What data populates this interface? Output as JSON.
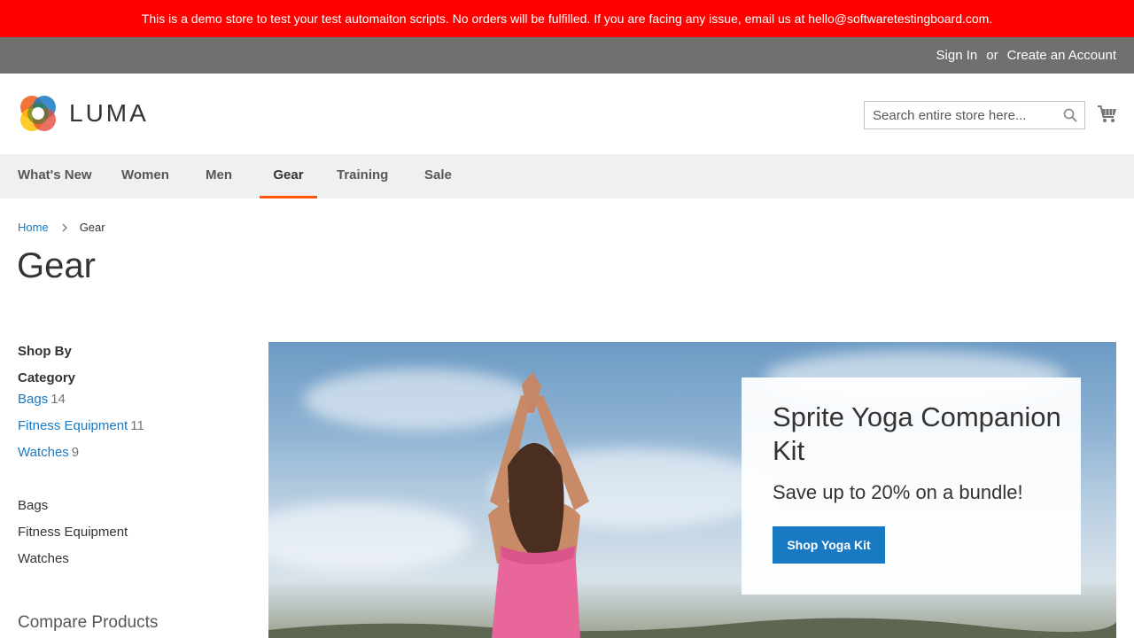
{
  "banner": {
    "text": "This is a demo store to test your test automaiton scripts. No orders will be fulfilled. If you are facing any issue, email us at hello@softwaretestingboard.com."
  },
  "header": {
    "sign_in": "Sign In",
    "or": "or",
    "create_account": "Create an Account",
    "logo_text": "LUMA",
    "search_placeholder": "Search entire store here..."
  },
  "nav": {
    "items": [
      {
        "label": "What's New"
      },
      {
        "label": "Women"
      },
      {
        "label": "Men"
      },
      {
        "label": "Gear"
      },
      {
        "label": "Training"
      },
      {
        "label": "Sale"
      }
    ],
    "active": "Gear"
  },
  "breadcrumbs": {
    "home": "Home",
    "current": "Gear"
  },
  "page_title": "Gear",
  "sidebar": {
    "shop_by": "Shop By",
    "filter_title": "Category",
    "filters": [
      {
        "label": "Bags",
        "count": "14"
      },
      {
        "label": "Fitness Equipment",
        "count": "11"
      },
      {
        "label": "Watches",
        "count": "9"
      }
    ],
    "categories": [
      {
        "label": "Bags"
      },
      {
        "label": "Fitness Equipment"
      },
      {
        "label": "Watches"
      }
    ],
    "compare_title": "Compare Products"
  },
  "hero": {
    "title": "Sprite Yoga Companion Kit",
    "subtitle": "Save up to 20% on a bundle!",
    "button": "Shop Yoga Kit"
  },
  "colors": {
    "banner": "#ff0101",
    "panel": "#6e716e",
    "link": "#1979c3",
    "nav_active": "#ff5501",
    "button": "#1979c3"
  },
  "icons": {
    "search": "search-icon",
    "cart": "cart-icon",
    "breadcrumb_separator": "chevron-right-icon"
  }
}
